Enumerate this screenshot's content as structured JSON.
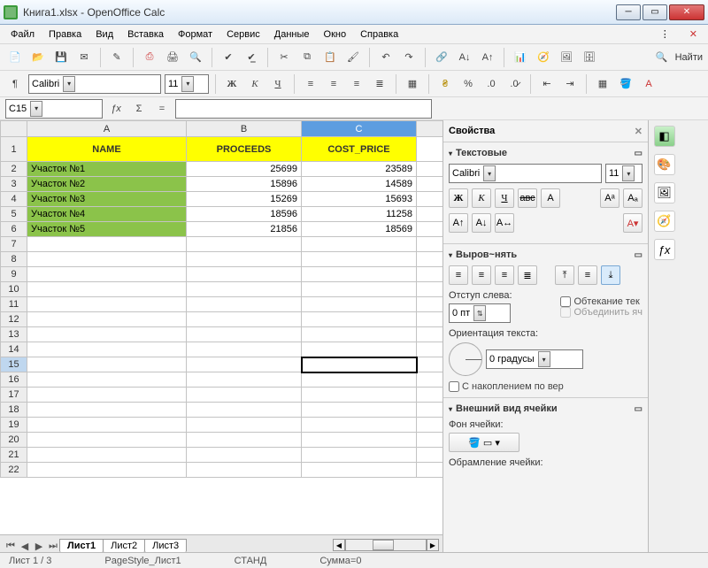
{
  "window": {
    "title": "Книга1.xlsx - OpenOffice Calc"
  },
  "menu": {
    "file": "Файл",
    "edit": "Правка",
    "view": "Вид",
    "insert": "Вставка",
    "format": "Формат",
    "service": "Сервис",
    "data": "Данные",
    "window": "Окно",
    "help": "Справка"
  },
  "toolbar2": {
    "font": "Calibri",
    "size": "11"
  },
  "find_label": "Найти",
  "cell_ref": "C15",
  "columns": [
    "A",
    "B",
    "C"
  ],
  "rows": [
    "1",
    "2",
    "3",
    "4",
    "5",
    "6",
    "7",
    "8",
    "9",
    "10",
    "11",
    "12",
    "13",
    "14",
    "15",
    "16",
    "17",
    "18",
    "19",
    "20",
    "21",
    "22"
  ],
  "headers": {
    "a": "NAME",
    "b": "PROCEEDS",
    "c": "COST_PRICE"
  },
  "data_rows": [
    {
      "name": "Участок №1",
      "proceeds": "25699",
      "cost": "23589"
    },
    {
      "name": "Участок №2",
      "proceeds": "15896",
      "cost": "14589"
    },
    {
      "name": "Участок №3",
      "proceeds": "15269",
      "cost": "15693"
    },
    {
      "name": "Участок №4",
      "proceeds": "18596",
      "cost": "11258"
    },
    {
      "name": "Участок №5",
      "proceeds": "21856",
      "cost": "18569"
    }
  ],
  "sheets": {
    "s1": "Лист1",
    "s2": "Лист2",
    "s3": "Лист3"
  },
  "sidebar": {
    "title": "Свойства",
    "text_panel": "Текстовые",
    "font": "Calibri",
    "size": "11",
    "align_panel": "Выров~нять",
    "indent_label": "Отступ слева:",
    "indent_value": "0 пт",
    "wrap": "Обтекание тек",
    "merge": "Объединить яч",
    "orient_label": "Ориентация текста:",
    "orient_val": "0 градусы",
    "stack": "С накоплением по вер",
    "cell_panel": "Внешний вид ячейки",
    "bg_label": "Фон ячейки:",
    "border_label": "Обрамление ячейки:"
  },
  "status": {
    "sheet": "Лист 1 / 3",
    "style": "PageStyle_Лист1",
    "mode": "СТАНД",
    "sum": "Сумма=0"
  }
}
